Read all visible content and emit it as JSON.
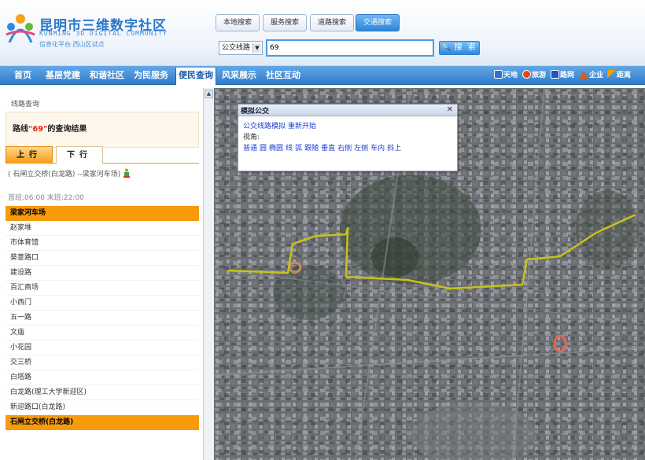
{
  "header": {
    "logo_cn": "昆明市三维数字社区",
    "logo_en": "KUNMING 3D DIGITAL COMMUNITY",
    "logo_sub": "信息化平台·西山区试点"
  },
  "search": {
    "tabs": [
      {
        "label": "本地搜索",
        "active": false
      },
      {
        "label": "服务搜索",
        "active": false
      },
      {
        "label": "道路搜索",
        "active": false
      },
      {
        "label": "交通搜索",
        "active": true
      }
    ],
    "select_value": "公交线路",
    "query": "69",
    "button_label": "搜 索"
  },
  "nav": {
    "items": [
      {
        "label": "首页",
        "active": false
      },
      {
        "label": "基层党建",
        "active": false
      },
      {
        "label": "和谐社区",
        "active": false
      },
      {
        "label": "为民服务",
        "active": false
      },
      {
        "label": "便民查询",
        "active": true
      },
      {
        "label": "风采展示",
        "active": false
      },
      {
        "label": "社区互动",
        "active": false
      }
    ],
    "quick_links": [
      {
        "label": "天地",
        "icon": "sky-earth-icon",
        "color": "#2f6fd6"
      },
      {
        "label": "旅游",
        "icon": "tourism-icon",
        "color": "#e8431c"
      },
      {
        "label": "路网",
        "icon": "road-network-icon",
        "color": "#1a56c4"
      },
      {
        "label": "企业",
        "icon": "house-icon",
        "color": "#e35a10"
      },
      {
        "label": "距离",
        "icon": "ruler-icon",
        "color": "#e7a20c"
      }
    ]
  },
  "panel": {
    "breadcrumb": "线路查询",
    "result_prefix": "路线",
    "result_query": "\"69\"",
    "result_suffix": "的查询结果",
    "direction_tabs": [
      {
        "label": "上行",
        "active": true
      },
      {
        "label": "下行",
        "active": false
      }
    ],
    "route_line": "( 石闸立交桥(白龙路) --梁家河车场)",
    "route_time": "首班:06:00 末班:22:00",
    "stops": [
      {
        "name": "梁家河车场",
        "highlight": true
      },
      {
        "name": "赵家堆",
        "highlight": false
      },
      {
        "name": "市体育馆",
        "highlight": false
      },
      {
        "name": "葵菱路口",
        "highlight": false
      },
      {
        "name": "建设路",
        "highlight": false
      },
      {
        "name": "百汇商场",
        "highlight": false
      },
      {
        "name": "小西门",
        "highlight": false
      },
      {
        "name": "五一路",
        "highlight": false
      },
      {
        "name": "文庙",
        "highlight": false
      },
      {
        "name": "小花园",
        "highlight": false
      },
      {
        "name": "交三桥",
        "highlight": false
      },
      {
        "name": "白塔路",
        "highlight": false
      },
      {
        "name": "白龙路(理工大学新迎区)",
        "highlight": false
      },
      {
        "name": "新迎路口(白龙路)",
        "highlight": false
      },
      {
        "name": "石闸立交桥(白龙路)",
        "highlight": true
      }
    ]
  },
  "sim": {
    "title": "模拟公交",
    "link_sim": "公交线路模拟",
    "link_restart": "重新开始",
    "view_label": "视角:",
    "views": [
      "普通",
      "圆",
      "椭圆",
      "线",
      "弧",
      "跟随",
      "垂直",
      "右侧",
      "左侧",
      "车内",
      "斜上"
    ]
  },
  "colors": {
    "nav_blue": "#2d7cc9",
    "highlight_orange": "#f79a0c",
    "route_yellow": "#c9c21a",
    "link_blue": "#1b3fd0"
  }
}
